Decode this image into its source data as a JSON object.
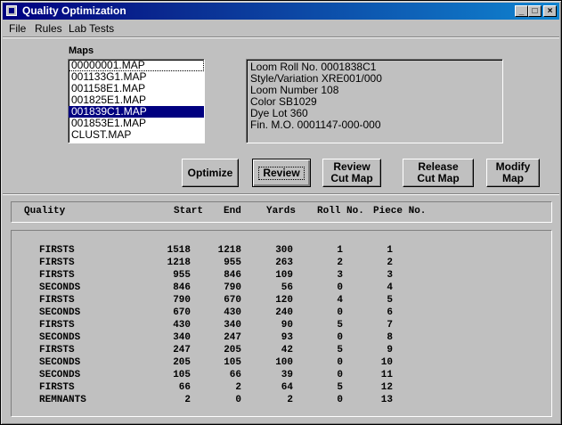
{
  "window": {
    "title": "Quality Optimization",
    "controls": {
      "minimize": "_",
      "maximize": "□",
      "close": "×"
    }
  },
  "menu": [
    "File",
    "Rules",
    "Lab Tests"
  ],
  "maps": {
    "label": "Maps",
    "items": [
      "00000001.MAP",
      "001133G1.MAP",
      "001158E1.MAP",
      "001825E1.MAP",
      "001839C1.MAP",
      "001853E1.MAP",
      "CLUST.MAP"
    ],
    "selected_index": 4
  },
  "info": {
    "lines": [
      "Loom Roll No. 0001838C1",
      "Style/Variation XRE001/000",
      "Loom Number  108",
      "Color SB1029",
      "Dye Lot 360",
      "Fin. M.O. 0001147-000-000"
    ]
  },
  "buttons": {
    "optimize": "Optimize",
    "review": "Review",
    "review_cut_map": [
      "Review",
      "Cut Map"
    ],
    "release_cut_map": [
      "Release",
      "Cut Map"
    ],
    "modify_map": [
      "Modify",
      "Map"
    ]
  },
  "table": {
    "headers": {
      "quality": "Quality",
      "start": "Start",
      "end": "End",
      "yards": "Yards",
      "roll_no": "Roll No.",
      "piece_no": "Piece No."
    },
    "rows": [
      [
        "FIRSTS",
        "1518",
        "1218",
        "300",
        "1",
        "1"
      ],
      [
        "FIRSTS",
        "1218",
        "955",
        "263",
        "2",
        "2"
      ],
      [
        "FIRSTS",
        "955",
        "846",
        "109",
        "3",
        "3"
      ],
      [
        "SECONDS",
        "846",
        "790",
        "56",
        "0",
        "4"
      ],
      [
        "FIRSTS",
        "790",
        "670",
        "120",
        "4",
        "5"
      ],
      [
        "SECONDS",
        "670",
        "430",
        "240",
        "0",
        "6"
      ],
      [
        "FIRSTS",
        "430",
        "340",
        "90",
        "5",
        "7"
      ],
      [
        "SECONDS",
        "340",
        "247",
        "93",
        "0",
        "8"
      ],
      [
        "FIRSTS",
        "247",
        "205",
        "42",
        "5",
        "9"
      ],
      [
        "SECONDS",
        "205",
        "105",
        "100",
        "0",
        "10"
      ],
      [
        "SECONDS",
        "105",
        "66",
        "39",
        "0",
        "11"
      ],
      [
        "FIRSTS",
        "66",
        "2",
        "64",
        "5",
        "12"
      ],
      [
        "REMNANTS",
        "2",
        "0",
        "2",
        "0",
        "13"
      ]
    ]
  }
}
